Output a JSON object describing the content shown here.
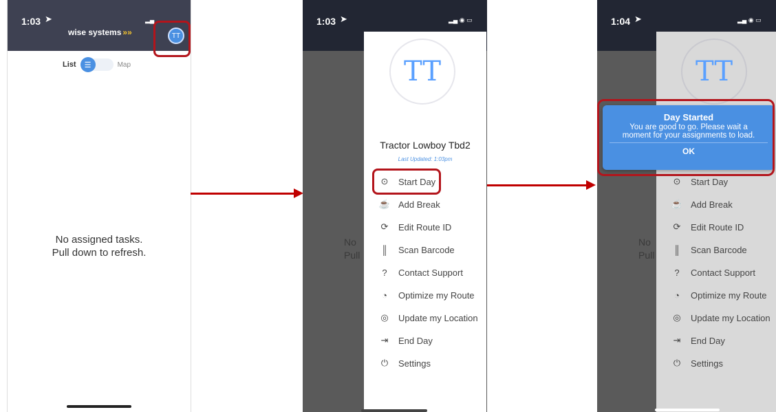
{
  "phone1": {
    "time": "1:03",
    "brand": "wise systems",
    "avatar": "TT",
    "toggle_list": "List",
    "toggle_map": "Map",
    "empty_line1": "No assigned tasks.",
    "empty_line2": "Pull down to refresh."
  },
  "phone2": {
    "time": "1:03",
    "avatar": "TT",
    "vehicle": "Tractor Lowboy Tbd2",
    "last_updated": "Last Updated: 1:03pm",
    "bg_text1": "No",
    "bg_text2": "Pull",
    "menu": [
      {
        "label": "Start Day",
        "icon": "play-circle-icon"
      },
      {
        "label": "Add Break",
        "icon": "coffee-cup-icon"
      },
      {
        "label": "Edit Route ID",
        "icon": "refresh-icon"
      },
      {
        "label": "Scan Barcode",
        "icon": "barcode-icon"
      },
      {
        "label": "Contact Support",
        "icon": "help-circle-icon"
      },
      {
        "label": "Optimize my Route",
        "icon": "optimize-icon"
      },
      {
        "label": "Update my Location",
        "icon": "location-pin-icon"
      },
      {
        "label": "End Day",
        "icon": "exit-icon"
      },
      {
        "label": "Settings",
        "icon": "power-icon"
      }
    ]
  },
  "phone3": {
    "time": "1:04",
    "avatar": "TT",
    "bg_text1": "No",
    "bg_text2": "Pull",
    "alert_title": "Day Started",
    "alert_line1": "You are good to go. Please wait a",
    "alert_line2": "moment for your assignments to load.",
    "alert_ok": "OK",
    "menu": [
      {
        "label": "Start Day"
      },
      {
        "label": "Add Break"
      },
      {
        "label": "Edit Route ID"
      },
      {
        "label": "Scan Barcode"
      },
      {
        "label": "Contact Support"
      },
      {
        "label": "Optimize my Route"
      },
      {
        "label": "Update my Location"
      },
      {
        "label": "End Day"
      },
      {
        "label": "Settings"
      }
    ]
  },
  "colors": {
    "header_bg": "#3e4152",
    "accent": "#4a90e2",
    "highlight": "#b3141b",
    "alert_bg": "#4a90e2"
  }
}
